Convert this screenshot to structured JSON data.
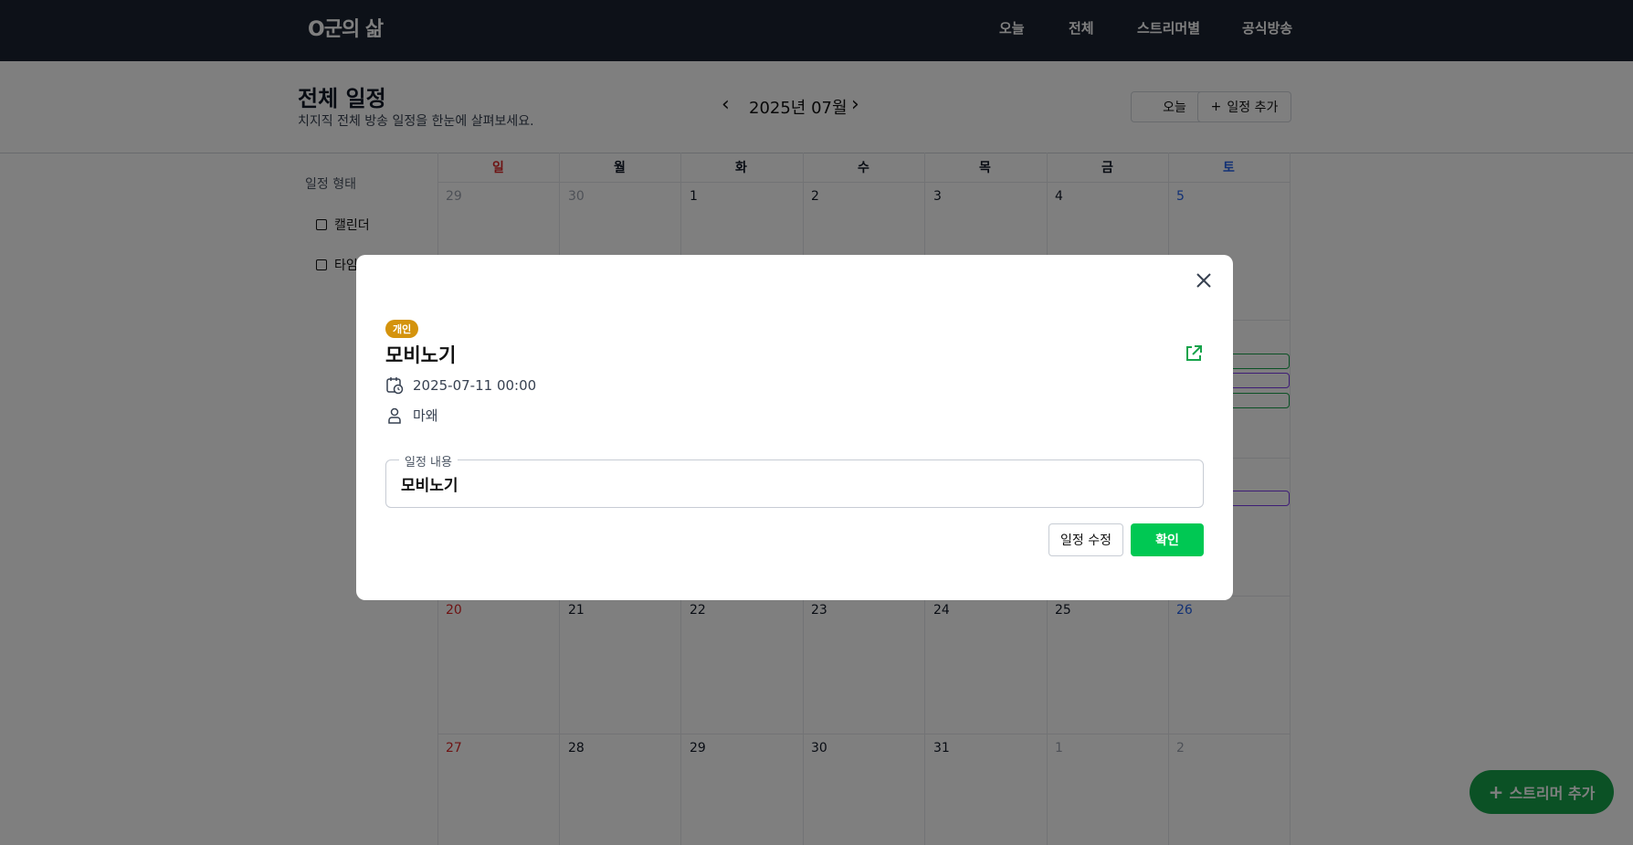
{
  "header": {
    "logo": "O군의 삶",
    "nav": [
      "오늘",
      "전체",
      "스트리머별",
      "공식방송"
    ]
  },
  "page": {
    "title": "전체 일정",
    "subtitle": "치지직 전체 방송 일정을 한눈에 살펴보세요.",
    "month": "2025년 07월",
    "today_btn": "오늘",
    "add_btn": "일정 추가"
  },
  "sidebar": {
    "title": "일정 형태",
    "items": [
      "캘린더",
      "타임"
    ]
  },
  "calendar": {
    "weekdays": [
      "일",
      "월",
      "화",
      "수",
      "목",
      "금",
      "토"
    ],
    "weeks": [
      [
        "29",
        "30",
        "1",
        "2",
        "3",
        "4",
        "5"
      ],
      [
        "20",
        "21",
        "22",
        "23",
        "24",
        "25",
        "26"
      ],
      [
        "27",
        "28",
        "29",
        "30",
        "31",
        "1",
        "2"
      ]
    ],
    "colors": {
      "sunday": "#dc2626",
      "saturday": "#2563eb",
      "other_month": "#9ca3af"
    }
  },
  "fab": {
    "label": "스트리머 추가"
  },
  "modal": {
    "badge": "개인",
    "title": "모비노기",
    "datetime": "2025-07-11 00:00",
    "person": "마왜",
    "field_label": "일정 내용",
    "field_value": "모비노기",
    "edit_btn": "일정 수정",
    "ok_btn": "확인",
    "badge_color": "#d4930d",
    "ok_color": "#00c853"
  }
}
